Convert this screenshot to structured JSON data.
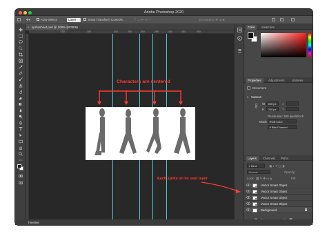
{
  "app_title": "Adobe Photoshop 2020",
  "options_bar": {
    "auto_select_label": "Auto-Select:",
    "auto_select_value": "Layer",
    "show_transform_label": "Show Transform Controls",
    "mode_3d_label": "3D Mode:"
  },
  "document": {
    "tab_label": "spritesheet.psd @ 100% (RGB/8)",
    "ruler_ticks": [
      "100",
      "150",
      "200",
      "250",
      "300",
      "350",
      "400",
      "450",
      "500"
    ],
    "zoom": "100%",
    "info": "Doc: 937.5K/2.34M"
  },
  "annotations": {
    "centered": "Characters are centered",
    "own_layer": "Each sprite on its own layer"
  },
  "timeline_label": "Timeline",
  "color_panel": {
    "tabs": [
      "Color",
      "Swatches"
    ],
    "foreground": "#111111",
    "background": "#ffffff",
    "hue_color": "#ff1e1e"
  },
  "properties_panel": {
    "tabs": [
      "Properties",
      "Adjustments",
      "Libraries"
    ],
    "kind": "Document",
    "section": "Canvas",
    "w_label": "W",
    "w_value": "600 px",
    "h_label": "H",
    "h_value": "200 px",
    "x_label": "X",
    "y_label": "Y",
    "resolution": "Resolution: 300 pixels/inch",
    "mode_label": "Mode",
    "mode_value": "RGB Color",
    "depth_value": "8 Bits/Channel"
  },
  "layers_panel": {
    "tabs": [
      "Layers",
      "Channels",
      "Paths"
    ],
    "kind_filter": "Kind",
    "blend_mode": "Normal",
    "opacity_label": "Opacity:",
    "lock_label": "Lock:",
    "fill_label": "Fill:",
    "layers": [
      {
        "name": "Vector Smart Object"
      },
      {
        "name": "Vector Smart Object"
      },
      {
        "name": "Vector Smart Object"
      },
      {
        "name": "Vector Smart Object"
      },
      {
        "name": "Background"
      }
    ]
  },
  "accent_annotation_color": "#ff3b30",
  "guide_color": "#52c5d6"
}
